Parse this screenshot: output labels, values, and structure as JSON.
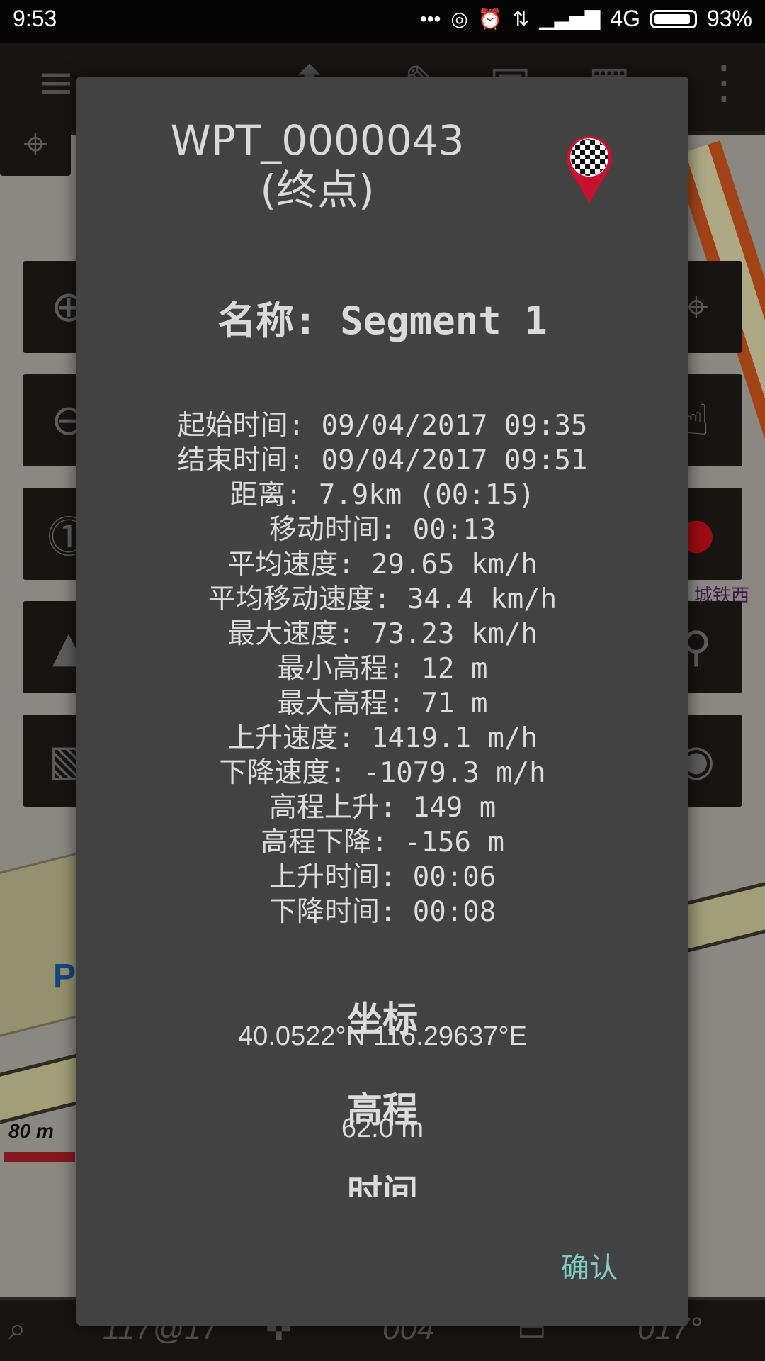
{
  "status_bar": {
    "time": "9:53",
    "network": "4G",
    "battery": "93%"
  },
  "map": {
    "scale_label": "80 m",
    "parking_label": "P",
    "street_label": "城铁西",
    "bottom_bar": {
      "left_value": "117@17",
      "middle_value": "004",
      "right_value": "017°"
    }
  },
  "dialog": {
    "title_line1": "WPT_0000043",
    "title_line2": "(终点)",
    "segment_name": "名称: Segment 1",
    "stats": [
      "起始时间: 09/04/2017 09:35",
      "结束时间: 09/04/2017 09:51",
      "距离: 7.9km (00:15)",
      "移动时间: 00:13",
      "平均速度: 29.65 km/h",
      "平均移动速度: 34.4 km/h",
      "最大速度: 73.23 km/h",
      "最小高程: 12 m",
      "最大高程: 71 m",
      "上升速度: 1419.1 m/h",
      "下降速度: -1079.3 m/h",
      "高程上升: 149 m",
      "高程下降: -156 m",
      "上升时间: 00:06",
      "下降时间: 00:08"
    ],
    "coords_heading": "坐标",
    "coords_value": "40.0522°N 116.29637°E",
    "elevation_heading": "高程",
    "elevation_value": "62.0 m",
    "time_heading": "时间",
    "confirm_label": "确认"
  },
  "colors": {
    "dialog_bg": "#424242",
    "accent": "#80cbc4",
    "pin_red": "#c8102e"
  }
}
